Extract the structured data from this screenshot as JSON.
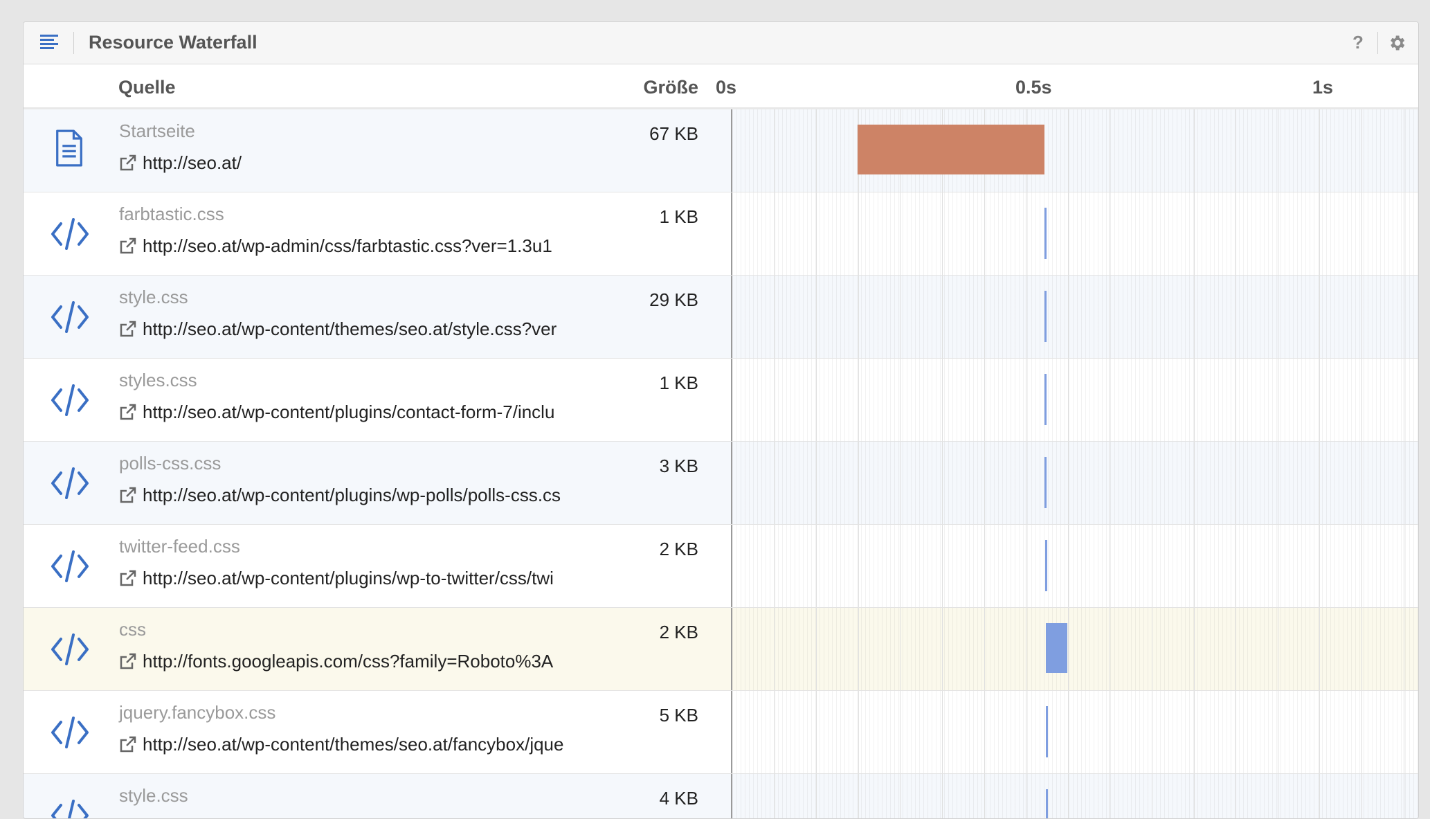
{
  "panel": {
    "title": "Resource Waterfall",
    "help_label": "?"
  },
  "columns": {
    "source": "Quelle",
    "size": "Größe",
    "ticks": [
      "0s",
      "0.5s",
      "1s"
    ]
  },
  "colors": {
    "document_bar": "#cd8366",
    "css_bar": "#7f9ee0",
    "icon_blue": "#3a6fc4",
    "highlight_row": "#fbf9ec",
    "alt_row": "#f5f8fc"
  },
  "timeline": {
    "start_s": 0,
    "end_s": 1.1,
    "tick_values": [
      0,
      0.5,
      1
    ]
  },
  "resources": [
    {
      "name": "Startseite",
      "url": "http://seo.at/",
      "size": "67 KB",
      "icon": "document-icon",
      "bar_start_s": 0.2,
      "bar_end_s": 0.5,
      "bar_type": "document"
    },
    {
      "name": "farbtastic.css",
      "url": "http://seo.at/wp-admin/css/farbtastic.css?ver=1.3u1",
      "size": "1 KB",
      "icon": "code-icon",
      "bar_start_s": 0.5,
      "bar_end_s": 0.503,
      "bar_type": "css"
    },
    {
      "name": "style.css",
      "url": "http://seo.at/wp-content/themes/seo.at/style.css?ver",
      "size": "29 KB",
      "icon": "code-icon",
      "bar_start_s": 0.5,
      "bar_end_s": 0.503,
      "bar_type": "css"
    },
    {
      "name": "styles.css",
      "url": "http://seo.at/wp-content/plugins/contact-form-7/inclu",
      "size": "1 KB",
      "icon": "code-icon",
      "bar_start_s": 0.5,
      "bar_end_s": 0.503,
      "bar_type": "css"
    },
    {
      "name": "polls-css.css",
      "url": "http://seo.at/wp-content/plugins/wp-polls/polls-css.cs",
      "size": "3 KB",
      "icon": "code-icon",
      "bar_start_s": 0.5,
      "bar_end_s": 0.503,
      "bar_type": "css"
    },
    {
      "name": "twitter-feed.css",
      "url": "http://seo.at/wp-content/plugins/wp-to-twitter/css/twi",
      "size": "2 KB",
      "icon": "code-icon",
      "bar_start_s": 0.501,
      "bar_end_s": 0.504,
      "bar_type": "css"
    },
    {
      "name": "css",
      "url": "http://fonts.googleapis.com/css?family=Roboto%3A",
      "size": "2 KB",
      "icon": "code-icon",
      "bar_start_s": 0.502,
      "bar_end_s": 0.536,
      "bar_type": "css",
      "highlight": true
    },
    {
      "name": "jquery.fancybox.css",
      "url": "http://seo.at/wp-content/themes/seo.at/fancybox/jque",
      "size": "5 KB",
      "icon": "code-icon",
      "bar_start_s": 0.502,
      "bar_end_s": 0.505,
      "bar_type": "css"
    },
    {
      "name": "style.css",
      "url": "",
      "size": "4 KB",
      "icon": "code-icon",
      "bar_start_s": 0.502,
      "bar_end_s": 0.505,
      "bar_type": "css"
    }
  ]
}
